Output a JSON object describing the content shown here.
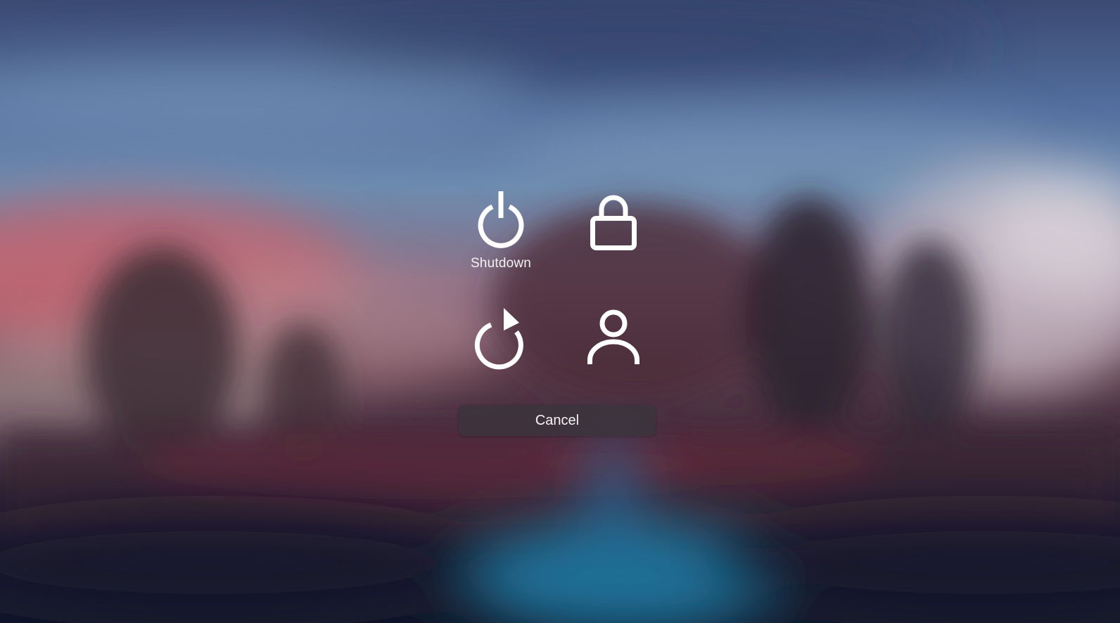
{
  "power_menu": {
    "options": [
      {
        "id": "shutdown",
        "icon": "power-icon",
        "label": "Shutdown"
      },
      {
        "id": "lock",
        "icon": "lock-icon",
        "label": ""
      },
      {
        "id": "restart",
        "icon": "restart-icon",
        "label": ""
      },
      {
        "id": "logout",
        "icon": "user-icon",
        "label": ""
      }
    ],
    "cancel_label": "Cancel"
  },
  "colors": {
    "icon": "#ffffff",
    "label": "#f2f2f2",
    "cancel_bg": "#3c343c"
  }
}
